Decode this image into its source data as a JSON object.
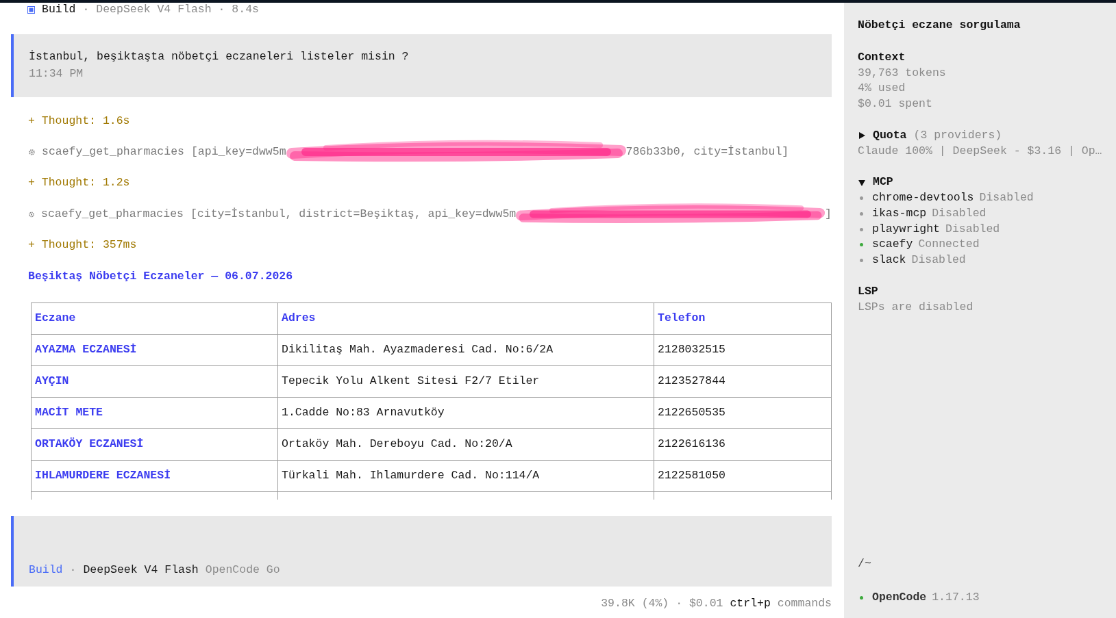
{
  "header": {
    "agent": "Build",
    "meta": "· DeepSeek V4 Flash · 8.4s"
  },
  "user_message": {
    "text": "İstanbul, beşiktaşta nöbetçi eczaneleri listeler misin ?",
    "time": "11:34 PM"
  },
  "transcript": [
    {
      "kind": "thought",
      "text": "+ Thought: 1.6s"
    },
    {
      "kind": "tool",
      "name": "scaefy_get_pharmacies",
      "before": "[api_key=dww5m",
      "after": "786b33b0, city=İstanbul]",
      "redacted": true
    },
    {
      "kind": "thought",
      "text": "+ Thought: 1.2s"
    },
    {
      "kind": "tool",
      "name": "scaefy_get_pharmacies",
      "before": "[city=İstanbul, district=Beşiktaş, api_key=dww5m",
      "after": "]",
      "redacted": true
    },
    {
      "kind": "thought",
      "text": "+ Thought: 357ms"
    },
    {
      "kind": "heading",
      "text": "Beşiktaş Nöbetçi Eczaneler — 06.07.2026"
    }
  ],
  "table": {
    "columns": [
      "Eczane",
      "Adres",
      "Telefon"
    ],
    "rows": [
      [
        "AYAZMA ECZANESİ",
        "Dikilitaş Mah. Ayazmaderesi Cad. No:6/2A",
        "2128032515"
      ],
      [
        "AYÇIN",
        "Tepecik Yolu Alkent Sitesi F2/7 Etiler",
        "2123527844"
      ],
      [
        "MACİT METE",
        "1.Cadde No:83 Arnavutköy",
        "2122650535"
      ],
      [
        "ORTAKÖY ECZANESİ",
        "Ortaköy Mah. Dereboyu Cad. No:20/A",
        "2122616136"
      ],
      [
        "IHLAMURDERE ECZANESİ",
        "Türkali Mah. Ihlamurdere Cad. No:114/A",
        "2122581050"
      ]
    ]
  },
  "prompt": {
    "agent": "Build",
    "separator": "·",
    "model": "DeepSeek V4 Flash",
    "provider": "OpenCode Go"
  },
  "status": {
    "usage": "39.8K (4%) · $0.01",
    "shortcut": "ctrl+p",
    "shortcut_label": "commands"
  },
  "sidebar": {
    "title": "Nöbetçi eczane sorgulama",
    "context": {
      "heading": "Context",
      "lines": [
        "39,763 tokens",
        "4% used",
        "$0.01 spent"
      ]
    },
    "quota": {
      "heading": "Quota",
      "count": "(3 providers)",
      "expanded": false,
      "summary": "Claude 100% | DeepSeek - $3.16 | Op…"
    },
    "mcp": {
      "heading": "MCP",
      "expanded": true,
      "servers": [
        {
          "name": "chrome-devtools",
          "status": "Disabled",
          "connected": false
        },
        {
          "name": "ikas-mcp",
          "status": "Disabled",
          "connected": false
        },
        {
          "name": "playwright",
          "status": "Disabled",
          "connected": false
        },
        {
          "name": "scaefy",
          "status": "Connected",
          "connected": true
        },
        {
          "name": "slack",
          "status": "Disabled",
          "connected": false
        }
      ]
    },
    "lsp": {
      "heading": "LSP",
      "text": "LSPs are disabled"
    },
    "cwd": "/~",
    "app": {
      "name": "OpenCode",
      "version": "1.17.13"
    }
  }
}
